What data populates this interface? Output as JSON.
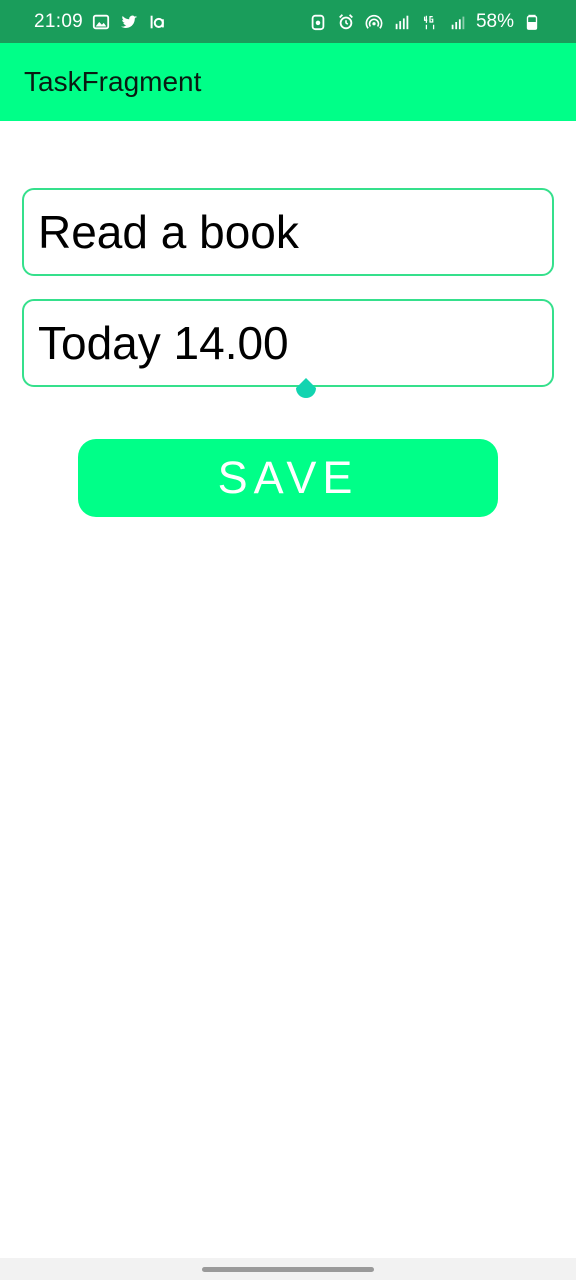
{
  "status_bar": {
    "time": "21:09",
    "left_icons": [
      "gallery-icon",
      "twitter-icon",
      "app-la-icon"
    ],
    "right_icons": [
      "android-icon",
      "alarm-icon",
      "hotspot-icon",
      "signal-r-icon",
      "signal-4g-icon",
      "signal-icon"
    ],
    "battery": "58%"
  },
  "app_bar": {
    "title": "TaskFragment"
  },
  "form": {
    "task_name": "Read a book",
    "task_time": "Today 14.00",
    "save_label": "SAVE"
  },
  "colors": {
    "status_bar": "#1a9d5b",
    "app_bar": "#00ff88",
    "field_border": "#35e08c",
    "caret": "#12d4b0"
  }
}
